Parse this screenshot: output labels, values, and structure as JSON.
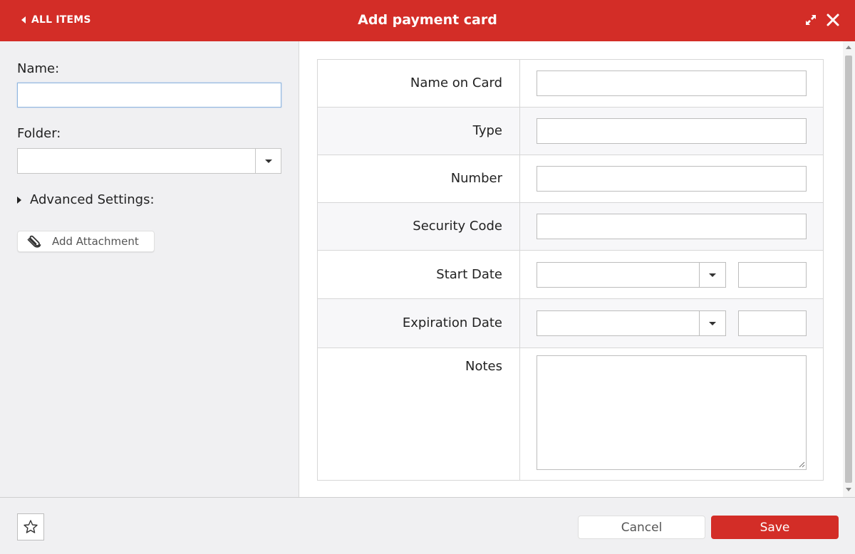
{
  "header": {
    "back_label": "ALL ITEMS",
    "title": "Add payment card",
    "expand_icon": "expand-icon",
    "close_icon": "close-icon"
  },
  "sidebar": {
    "name_label": "Name:",
    "name_value": "",
    "folder_label": "Folder:",
    "folder_value": "",
    "advanced_label": "Advanced Settings:",
    "attachment_label": "Add Attachment",
    "attachment_icon": "paperclip-icon"
  },
  "form": {
    "name_on_card": {
      "label": "Name on Card",
      "value": ""
    },
    "type": {
      "label": "Type",
      "value": ""
    },
    "number": {
      "label": "Number",
      "value": ""
    },
    "security_code": {
      "label": "Security Code",
      "value": ""
    },
    "start_date": {
      "label": "Start Date",
      "month": "",
      "year": ""
    },
    "expiration_date": {
      "label": "Expiration Date",
      "month": "",
      "year": ""
    },
    "notes": {
      "label": "Notes",
      "value": ""
    }
  },
  "footer": {
    "favorite_icon": "star-icon",
    "cancel_label": "Cancel",
    "save_label": "Save"
  },
  "colors": {
    "brand": "#d32d27",
    "panel_bg": "#f0f0f2",
    "focus_border": "#8fb6df"
  }
}
